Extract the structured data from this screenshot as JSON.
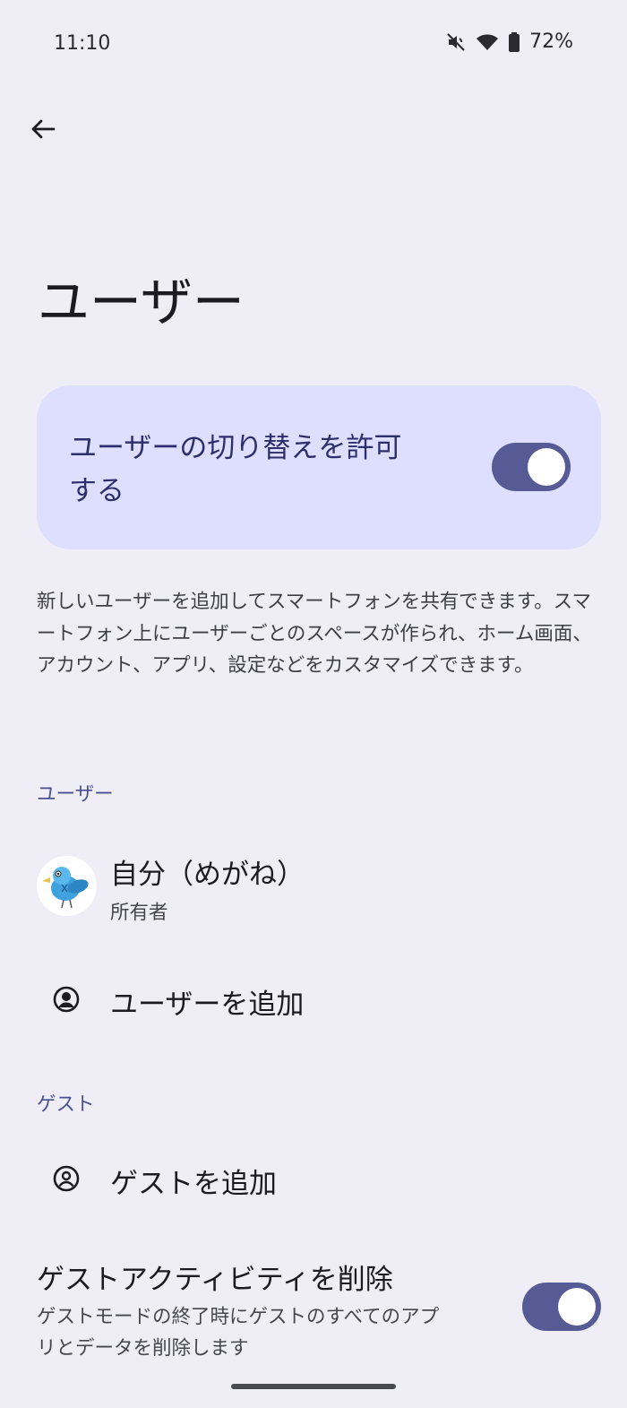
{
  "status_bar": {
    "time": "11:10",
    "battery": "72%",
    "icons": [
      "mute-icon",
      "wifi-icon",
      "battery-icon"
    ]
  },
  "page": {
    "title": "ユーザー"
  },
  "allow_switch": {
    "label": "ユーザーの切り替えを許可する",
    "enabled": true
  },
  "description": "新しいユーザーを追加してスマートフォンを共有できます。スマートフォン上にユーザーごとのスペースが作られ、ホーム画面、アカウント、アプリ、設定などをカスタマイズできます。",
  "users_section": {
    "header": "ユーザー",
    "current_user": {
      "name": "自分（めがね）",
      "role": "所有者"
    },
    "add_user_label": "ユーザーを追加"
  },
  "guest_section": {
    "header": "ゲスト",
    "add_guest_label": "ゲストを追加",
    "delete_activity": {
      "title": "ゲストアクティビティを削除",
      "subtitle": "ゲストモードの終了時にゲストのすべてのアプリとデータを削除します",
      "enabled": true
    }
  },
  "colors": {
    "background": "#EFEEF6",
    "accent": "#565B96",
    "card": "#DEDEFE",
    "section_header": "#4A4F90"
  }
}
